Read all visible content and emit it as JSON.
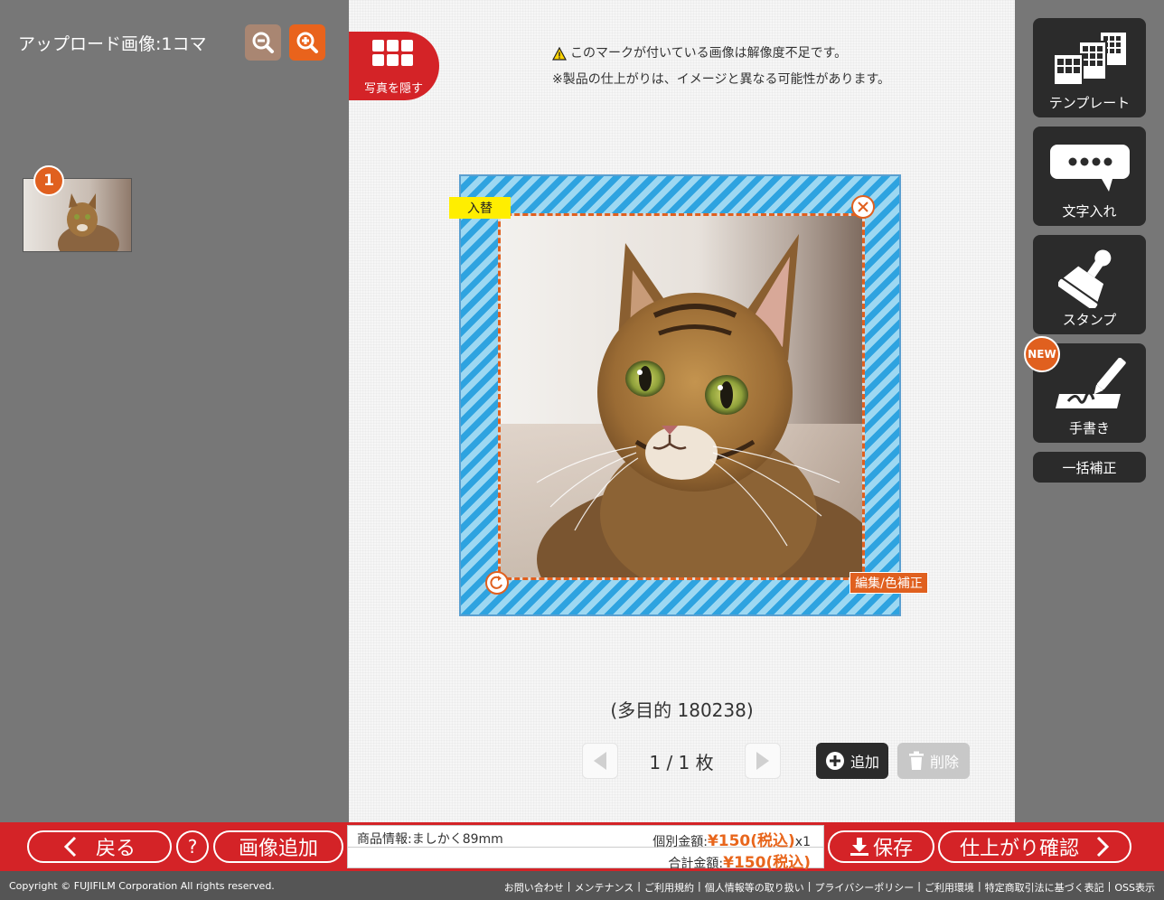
{
  "left_panel": {
    "upload_title": "アップロード画像:1コマ",
    "thumbnail_badge": "1"
  },
  "canvas": {
    "hide_photos_label": "写真を隠す",
    "notice_line1": "このマークが付いている画像は解像度不足です。",
    "notice_line2": "※製品の仕上がりは、イメージと異なる可能性があります。",
    "replace_label": "入替",
    "edit_label": "編集/色補正",
    "product_code": "(多目的 180238)",
    "page_indicator": "1 / 1 枚",
    "add_label": "追加",
    "delete_label": "削除"
  },
  "tools": {
    "template_label": "テンプレート",
    "text_label": "文字入れ",
    "stamp_label": "スタンプ",
    "handwriting_label": "手書き",
    "new_badge": "NEW",
    "bulk_correct_label": "一括補正"
  },
  "bottom_bar": {
    "back_label": "戻る",
    "help_label": "?",
    "add_image_label": "画像追加",
    "product_info": "商品情報:ましかく89mm",
    "unit_price_label": "個別金額:",
    "unit_price": "¥150(税込)",
    "quantity": "x1",
    "total_price_label": "合計金額:",
    "total_price": "¥150(税込)",
    "save_label": "保存",
    "confirm_label": "仕上がり確認"
  },
  "footer": {
    "copyright": "Copyright © FUJIFILM Corporation All rights reserved.",
    "links": [
      "お問い合わせ",
      "メンテナンス",
      "ご利用規約",
      "個人情報等の取り扱い",
      "プライバシーポリシー",
      "ご利用環境",
      "特定商取引法に基づく表記",
      "OSS表示"
    ]
  },
  "colors": {
    "brand_red": "#d42327",
    "accent_orange": "#e0601f",
    "frame_blue": "#2ea3e0",
    "warning_yellow": "#ffee00"
  }
}
